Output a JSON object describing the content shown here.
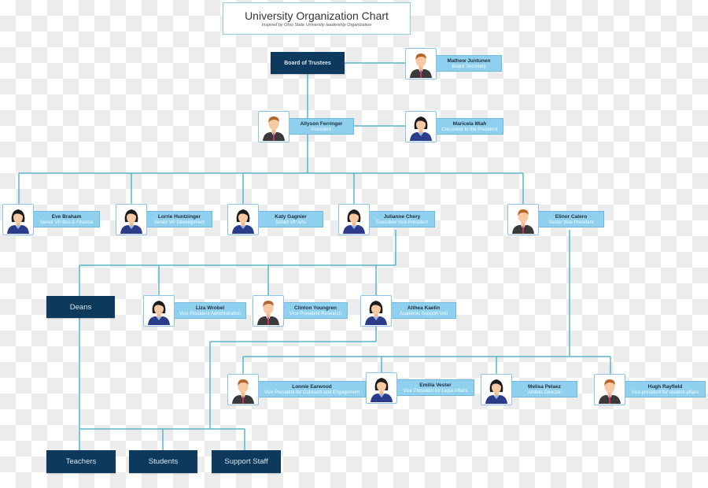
{
  "header": {
    "title": "University Organization Chart",
    "subtitle": "Inspired by Ohio State University leadership Organization"
  },
  "colors": {
    "connector": "#5bb5c8",
    "dark_box": "#0d3a5c",
    "label_fill": "#8fd0ee",
    "photo_border": "#8fc3e6"
  },
  "units": {
    "board": "Board of Trustees",
    "deans": "Deans",
    "teachers": "Teachers",
    "students": "Students",
    "support_staff": "Support Staff"
  },
  "people": {
    "mathew": {
      "name": "Mathew Juntunen",
      "role": "Board Secretary",
      "icon": "male-avatar-icon"
    },
    "allyson": {
      "name": "Allyson Ferringer",
      "role": "President",
      "icon": "male-avatar-icon"
    },
    "maricela": {
      "name": "Maricela Miah",
      "role": "Counselor to the President",
      "icon": "female-avatar-icon"
    },
    "eve": {
      "name": "Eve Braham",
      "role": "Senior VP Bus & Finance",
      "icon": "female-avatar-icon"
    },
    "lorrie": {
      "name": "Lorrie Huntzinger",
      "role": "Senior VP Development",
      "icon": "female-avatar-icon"
    },
    "katy": {
      "name": "Katy Gagnier",
      "role": "Senior VP Arts",
      "icon": "female-avatar-icon"
    },
    "julianne": {
      "name": "Julianne Chery",
      "role": "Executive Vice President",
      "icon": "female-avatar-icon"
    },
    "elinor": {
      "name": "Elinor Calero",
      "role": "Senior Vice President",
      "icon": "male-avatar-icon"
    },
    "liza": {
      "name": "Liza Wrobel",
      "role": "Vice President Administration",
      "icon": "female-avatar-icon"
    },
    "clinton": {
      "name": "Clinton Youngren",
      "role": "Vice President Research",
      "icon": "male-avatar-icon"
    },
    "althea": {
      "name": "Althea Kaelin",
      "role": "Academic Support Unit",
      "icon": "female-avatar-icon"
    },
    "lonnie": {
      "name": "Lonnie Earwood",
      "role": "Vice President for Outreach and Engagement",
      "icon": "male-avatar-icon"
    },
    "emilia": {
      "name": "Emilia Vester",
      "role": "Vice President for Legal Affairs",
      "icon": "female-avatar-icon"
    },
    "melisa": {
      "name": "Melisa Pelaez",
      "role": "Athletic Director",
      "icon": "female-avatar-icon"
    },
    "hugh": {
      "name": "Hugh Rayfield",
      "role": "Vice president for student affairs",
      "icon": "male-avatar-icon"
    }
  }
}
